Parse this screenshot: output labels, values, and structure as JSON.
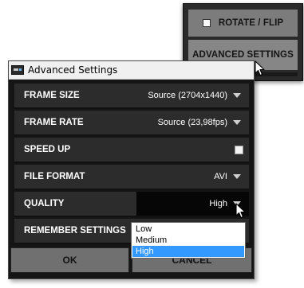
{
  "top_menu": {
    "items": [
      {
        "label": "ROTATE / FLIP",
        "checked": false
      },
      {
        "label": "ADVANCED SETTINGS"
      }
    ]
  },
  "dialog": {
    "title": "Advanced Settings",
    "rows": [
      {
        "label": "FRAME SIZE",
        "value": "Source (2704x1440)"
      },
      {
        "label": "FRAME RATE",
        "value": "Source (23,98fps)"
      },
      {
        "label": "SPEED UP",
        "checked": false
      },
      {
        "label": "FILE FORMAT",
        "value": "AVI"
      },
      {
        "label": "QUALITY",
        "value": "High"
      },
      {
        "label": "REMEMBER SETTINGS"
      }
    ],
    "buttons": {
      "ok": "OK",
      "cancel": "CANCEL"
    }
  },
  "quality_options": [
    "Low",
    "Medium",
    "High"
  ],
  "quality_selected": "High",
  "colors": {
    "dialog_bg": "#151515",
    "row_bg": "#2c2c2c",
    "button_bg": "#707070",
    "selection": "#3399ff"
  },
  "icons": {
    "title": "app-icon",
    "dropdown": "triangle-down-icon",
    "cursor": "mouse-pointer-icon"
  }
}
